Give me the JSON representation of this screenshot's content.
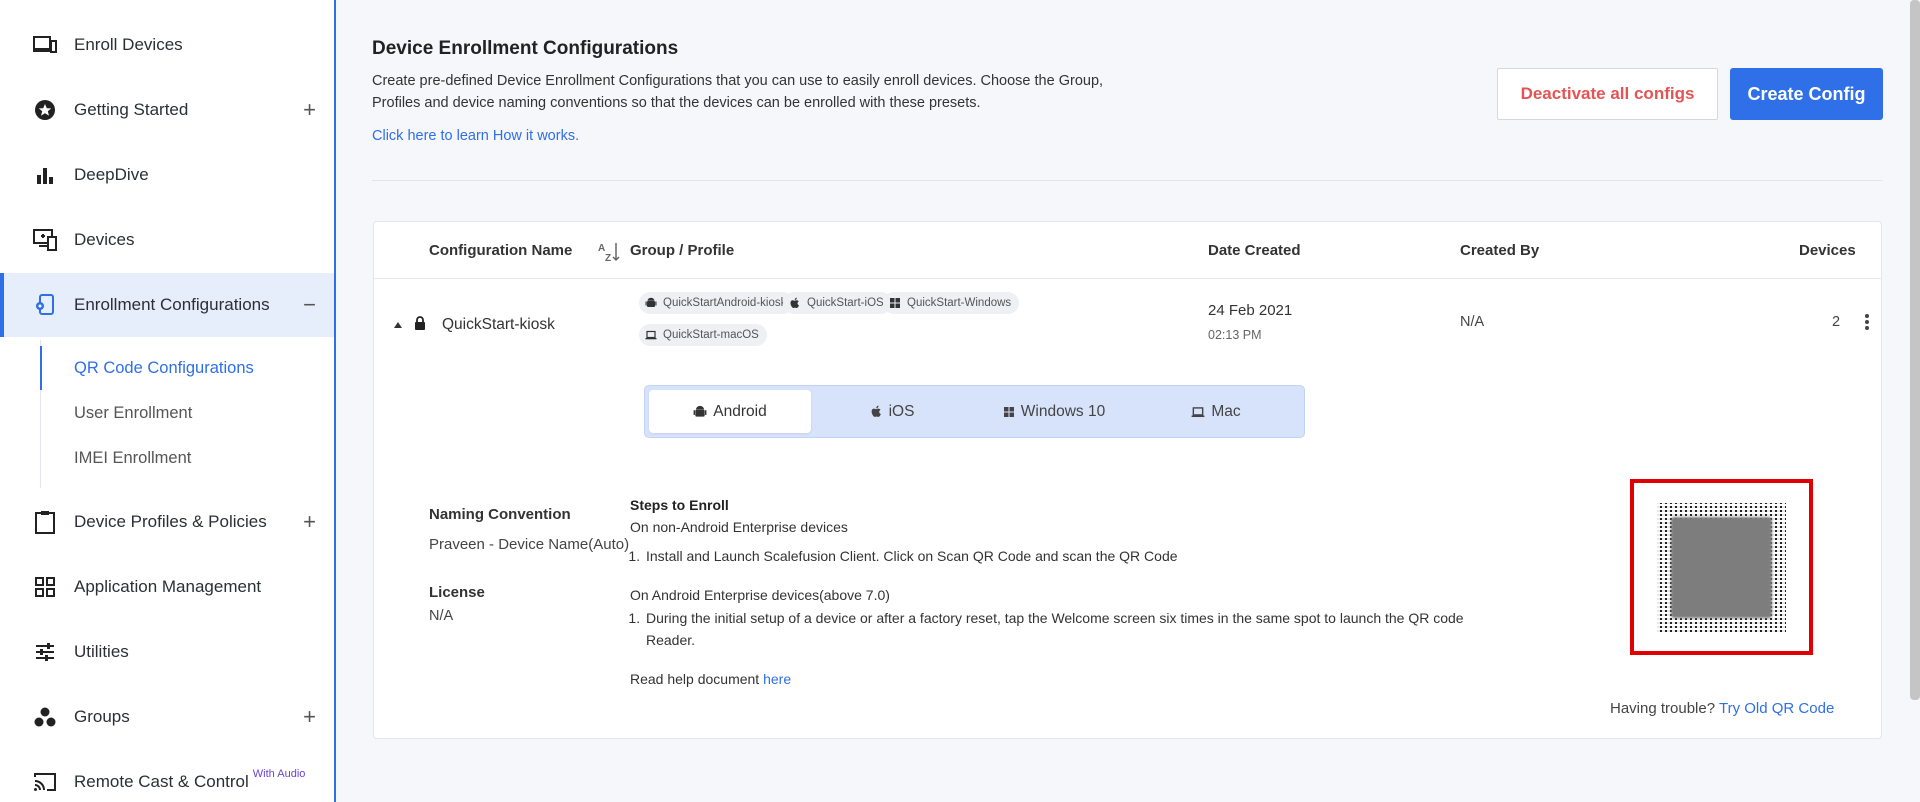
{
  "sidebar": {
    "items": [
      {
        "label": "Enroll Devices",
        "icon": "devices-icon",
        "expandable": false
      },
      {
        "label": "Getting Started",
        "icon": "star-icon",
        "expandable": true
      },
      {
        "label": "DeepDive",
        "icon": "bar-chart-icon",
        "expandable": false
      },
      {
        "label": "Devices",
        "icon": "monitor-icon",
        "expandable": false
      },
      {
        "label": "Enrollment Configurations",
        "icon": "enrollment-icon",
        "expandable": true,
        "expanded": true
      },
      {
        "label": "Device Profiles & Policies",
        "icon": "clipboard-icon",
        "expandable": true
      },
      {
        "label": "Application Management",
        "icon": "grid-icon",
        "expandable": false
      },
      {
        "label": "Utilities",
        "icon": "sliders-icon",
        "expandable": false
      },
      {
        "label": "Groups",
        "icon": "groups-icon",
        "expandable": true
      },
      {
        "label": "Remote Cast & Control",
        "icon": "cast-icon",
        "badge": "With Audio"
      }
    ],
    "subitems": [
      {
        "label": "QR Code Configurations",
        "active": true
      },
      {
        "label": "User Enrollment"
      },
      {
        "label": "IMEI Enrollment"
      }
    ]
  },
  "header": {
    "title": "Device Enrollment Configurations",
    "description": "Create pre-defined Device Enrollment Configurations that you can use to easily enroll devices. Choose the Group, Profiles and device naming conventions so that the devices can be enrolled with these presets.",
    "learn_link": "Click here to learn How it works.",
    "deactivate_label": "Deactivate all configs",
    "create_label": "Create Config"
  },
  "table": {
    "columns": [
      "Configuration Name",
      "Group / Profile",
      "Date Created",
      "Created By",
      "Devices"
    ],
    "row": {
      "name": "QuickStart-kiosk",
      "profiles": [
        {
          "label": "QuickStartAndroid-kiosk",
          "icon": "android-icon"
        },
        {
          "label": "QuickStart-iOS",
          "icon": "apple-icon"
        },
        {
          "label": "QuickStart-Windows",
          "icon": "windows-icon"
        },
        {
          "label": "QuickStart-macOS",
          "icon": "laptop-icon"
        }
      ],
      "date": "24 Feb 2021",
      "time": "02:13 PM",
      "created_by": "N/A",
      "devices": "2"
    }
  },
  "os_tabs": [
    {
      "label": "Android",
      "icon": "android-icon",
      "active": true
    },
    {
      "label": "iOS",
      "icon": "apple-icon"
    },
    {
      "label": "Windows 10",
      "icon": "windows-icon"
    },
    {
      "label": "Mac",
      "icon": "laptop-icon"
    }
  ],
  "details": {
    "naming_label": "Naming Convention",
    "naming_value": "Praveen - Device Name(Auto)",
    "license_label": "License",
    "license_value": "N/A"
  },
  "steps": {
    "title": "Steps to Enroll",
    "non_ae_title": "On non-Android Enterprise devices",
    "non_ae_step1": "Install and Launch Scalefusion Client. Click on Scan QR Code and scan the QR Code",
    "ae_title": "On Android Enterprise devices(above 7.0)",
    "ae_step1": "During the initial setup of a device or after a factory reset, tap the Welcome screen six times in the same spot to launch the QR code Reader.",
    "help_text": "Read help document",
    "help_link": "here"
  },
  "qr": {
    "trouble_text": "Having trouble?",
    "trouble_link": "Try Old QR Code"
  },
  "colors": {
    "accent": "#2f6fe8",
    "danger": "#e45454",
    "highlight": "#e00000"
  }
}
